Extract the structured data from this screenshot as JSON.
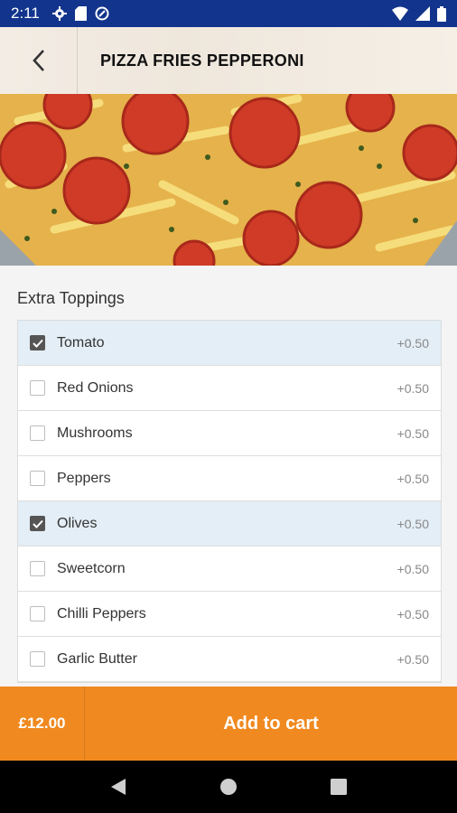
{
  "status_bar": {
    "time": "2:11"
  },
  "header": {
    "title": "PIZZA FRIES PEPPERONI"
  },
  "toppings": {
    "section_title": "Extra Toppings",
    "items": [
      {
        "label": "Tomato",
        "price": "+0.50",
        "checked": true
      },
      {
        "label": "Red Onions",
        "price": "+0.50",
        "checked": false
      },
      {
        "label": "Mushrooms",
        "price": "+0.50",
        "checked": false
      },
      {
        "label": "Peppers",
        "price": "+0.50",
        "checked": false
      },
      {
        "label": "Olives",
        "price": "+0.50",
        "checked": true
      },
      {
        "label": "Sweetcorn",
        "price": "+0.50",
        "checked": false
      },
      {
        "label": "Chilli Peppers",
        "price": "+0.50",
        "checked": false
      },
      {
        "label": "Garlic Butter",
        "price": "+0.50",
        "checked": false
      }
    ]
  },
  "footer": {
    "total": "£12.00",
    "add_label": "Add to cart"
  },
  "colors": {
    "status_bar": "#12348c",
    "accent": "#f0891f",
    "selected_row": "#e3eef6"
  }
}
